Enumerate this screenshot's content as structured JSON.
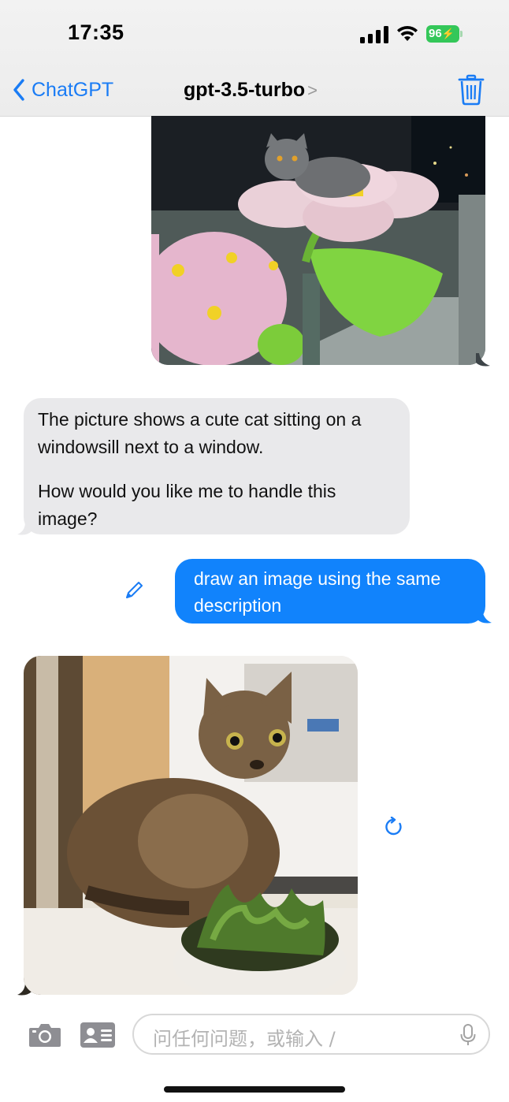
{
  "status_bar": {
    "time": "17:35",
    "battery": "96"
  },
  "nav": {
    "back_label": "ChatGPT",
    "title": "gpt-3.5-turbo",
    "title_chevron": ">"
  },
  "messages": {
    "assistant_reply": {
      "paragraph1": "The picture shows a cute cat sitting on a windowsill next to a window.",
      "paragraph2": "How would you like me to handle this image?"
    },
    "user_prompt": "draw an image using the same description"
  },
  "input": {
    "placeholder": "问任何问题，或输入 /"
  },
  "colors": {
    "accent": "#1a7cf5",
    "user_bubble": "#1183fc",
    "assistant_bubble": "#e9e9eb",
    "battery": "#34c759"
  },
  "icons": [
    "chevron-left-icon",
    "trash-icon",
    "edit-icon",
    "refresh-icon",
    "camera-icon",
    "contact-card-icon",
    "mic-icon"
  ]
}
